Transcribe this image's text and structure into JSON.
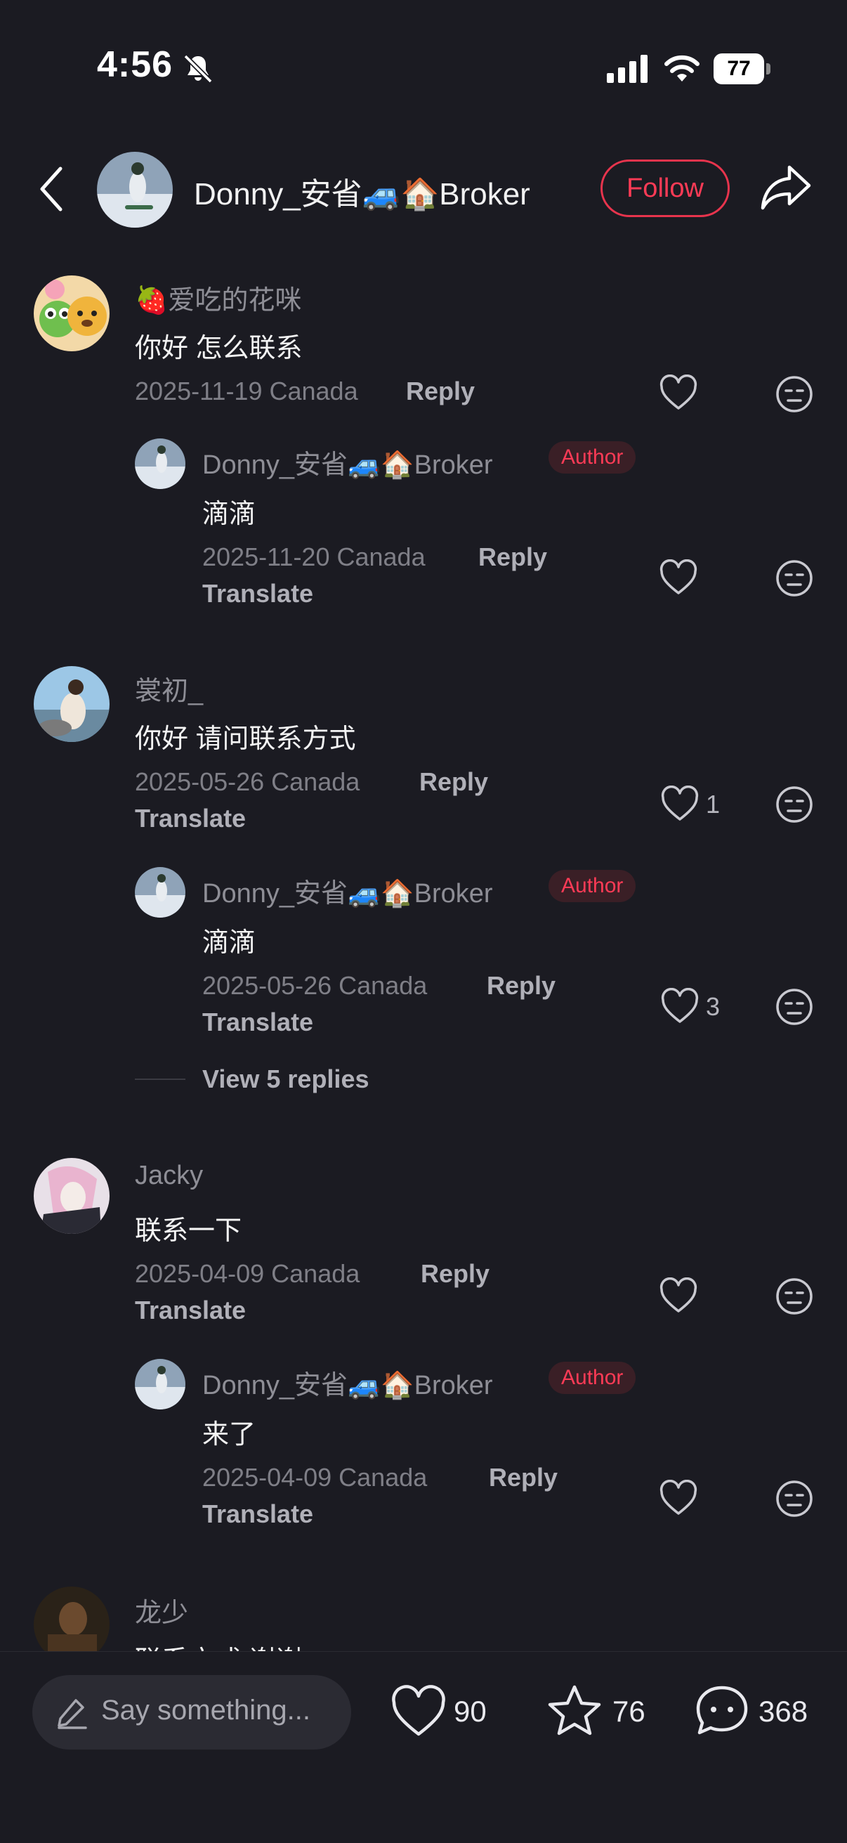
{
  "status_bar": {
    "time": "4:56",
    "battery": "77"
  },
  "header": {
    "username": "Donny_安省🚙🏠Broker",
    "follow_label": "Follow"
  },
  "comments": [
    {
      "username": "🍓爱吃的花咪",
      "text": "你好 怎么联系",
      "date": "2025-11-19 Canada",
      "reply_label": "Reply",
      "likes": "",
      "reply": {
        "username": "Donny_安省🚙🏠Broker",
        "badge": "Author",
        "text": "滴滴",
        "date": "2025-11-20 Canada",
        "reply_label": "Reply",
        "translate_label": "Translate",
        "likes": ""
      }
    },
    {
      "username": "裳初_",
      "text": "你好 请问联系方式",
      "date": "2025-05-26 Canada",
      "reply_label": "Reply",
      "translate_label": "Translate",
      "likes": "1",
      "reply": {
        "username": "Donny_安省🚙🏠Broker",
        "badge": "Author",
        "text": "滴滴",
        "date": "2025-05-26 Canada",
        "reply_label": "Reply",
        "translate_label": "Translate",
        "likes": "3"
      },
      "view_replies": "View 5 replies"
    },
    {
      "username": "Jacky",
      "text": "联系一下",
      "date": "2025-04-09 Canada",
      "reply_label": "Reply",
      "translate_label": "Translate",
      "likes": "",
      "reply": {
        "username": "Donny_安省🚙🏠Broker",
        "badge": "Author",
        "text": "来了",
        "date": "2025-04-09 Canada",
        "reply_label": "Reply",
        "translate_label": "Translate",
        "likes": ""
      }
    },
    {
      "username": "龙少",
      "text": "联系方式 谢谢"
    }
  ],
  "bottom_bar": {
    "placeholder": "Say something...",
    "likes": "90",
    "favorites": "76",
    "comments": "368"
  }
}
